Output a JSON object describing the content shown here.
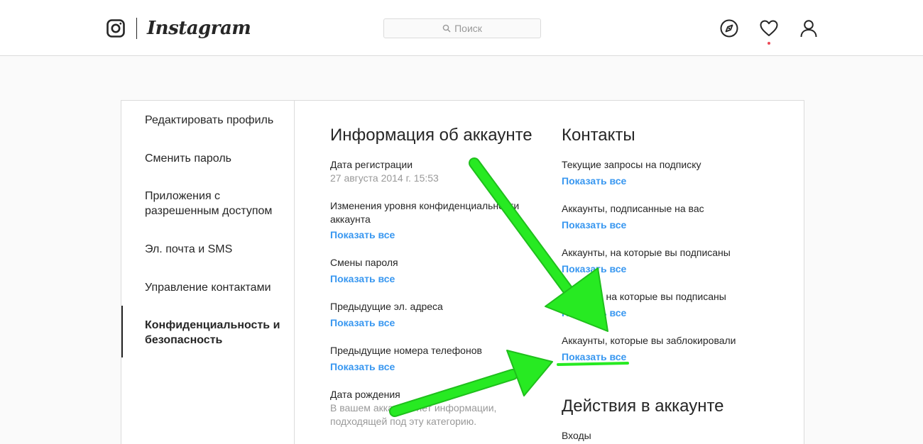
{
  "header": {
    "wordmark": "Instagram",
    "search_placeholder": "Поиск",
    "icons": [
      "instagram-glyph-icon",
      "search-icon",
      "compass-icon",
      "heart-icon",
      "user-icon"
    ],
    "accent_color": "#3897f0",
    "notification_color": "#ed4956"
  },
  "sidebar": {
    "items": [
      {
        "label": "Редактировать профиль"
      },
      {
        "label": "Сменить пароль"
      },
      {
        "label": "Приложения с разрешенным доступом"
      },
      {
        "label": "Эл. почта и SMS"
      },
      {
        "label": "Управление контактами"
      },
      {
        "label": "Конфиденциальность и безопасность"
      }
    ],
    "active_index": 5
  },
  "account_info": {
    "title": "Информация об аккаунте",
    "fields": [
      {
        "label": "Дата регистрации",
        "value": "27 августа 2014 г. 15:53"
      },
      {
        "label": "Изменения уровня конфиденциальности аккаунта",
        "link": "Показать все"
      },
      {
        "label": "Смены пароля",
        "link": "Показать все"
      },
      {
        "label": "Предыдущие эл. адреса",
        "link": "Показать все"
      },
      {
        "label": "Предыдущие номера телефонов",
        "link": "Показать все"
      },
      {
        "label": "Дата рождения",
        "value": "В вашем аккаунте нет информации, подходящей под эту категорию."
      }
    ]
  },
  "contacts": {
    "title": "Контакты",
    "fields": [
      {
        "label": "Текущие запросы на подписку",
        "link": "Показать все"
      },
      {
        "label": "Аккаунты, подписанные на вас",
        "link": "Показать все"
      },
      {
        "label": "Аккаунты, на которые вы подписаны",
        "link": "Показать все"
      },
      {
        "label": "Хэштеги, на которые вы подписаны",
        "link": "Показать все"
      },
      {
        "label": "Аккаунты, которые вы заблокировали",
        "link": "Показать все"
      }
    ]
  },
  "account_actions": {
    "title": "Действия в аккаунте",
    "fields": [
      {
        "label": "Входы"
      }
    ]
  },
  "annotation": {
    "arrow_color": "#22e01f"
  }
}
